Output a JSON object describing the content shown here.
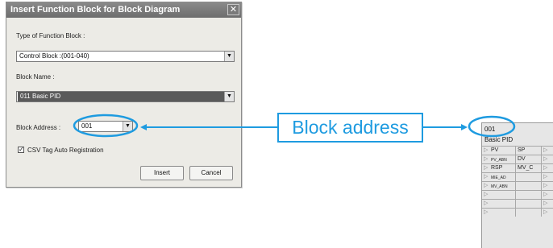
{
  "dialog": {
    "title": "Insert Function Block for Block Diagram",
    "close_glyph": "✕",
    "type_label": "Type of Function Block :",
    "type_value": "Control Block :(001-040)",
    "name_label": "Block Name :",
    "name_value": "011  Basic PID",
    "address_label": "Block Address :",
    "address_value": "001",
    "csv_label": "CSV Tag Auto Registration",
    "csv_checked": "✓",
    "dropdown_glyph": "▼",
    "insert_label": "Insert",
    "cancel_label": "Cancel"
  },
  "callout": {
    "text": "Block address",
    "color": "#1e9be0"
  },
  "function_block": {
    "address": "001",
    "name": "Basic PID",
    "rows": [
      {
        "in": "PV",
        "out": "SP"
      },
      {
        "in": "PV_ABN",
        "out": "DV"
      },
      {
        "in": "RSP",
        "out": "MV_C"
      },
      {
        "in": "MIE_AD",
        "out": ""
      },
      {
        "in": "MV_ABN",
        "out": ""
      },
      {
        "in": "",
        "out": ""
      },
      {
        "in": "",
        "out": ""
      },
      {
        "in": "",
        "out": ""
      }
    ]
  }
}
